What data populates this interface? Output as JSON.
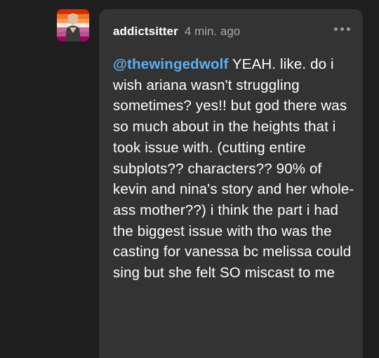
{
  "comment": {
    "username": "addictsitter",
    "timestamp": "4 min. ago",
    "mention": "@thewingedwolf",
    "text": " YEAH. like. do i wish ariana wasn't struggling sometimes? yes!! but god there was so much about in the heights that i took issue with. (cutting entire subplots?? characters?? 90% of kevin and nina's story and her whole-ass mother??) i think the part i had the biggest issue with tho was the casting for vanessa bc melissa could sing but she felt SO miscast to me",
    "more_icon": "more-horizontal-icon"
  },
  "colors": {
    "background": "#1e1e1e",
    "bubble": "#333333",
    "mention": "#5ab1f3",
    "timestamp": "#a8a8a8"
  }
}
